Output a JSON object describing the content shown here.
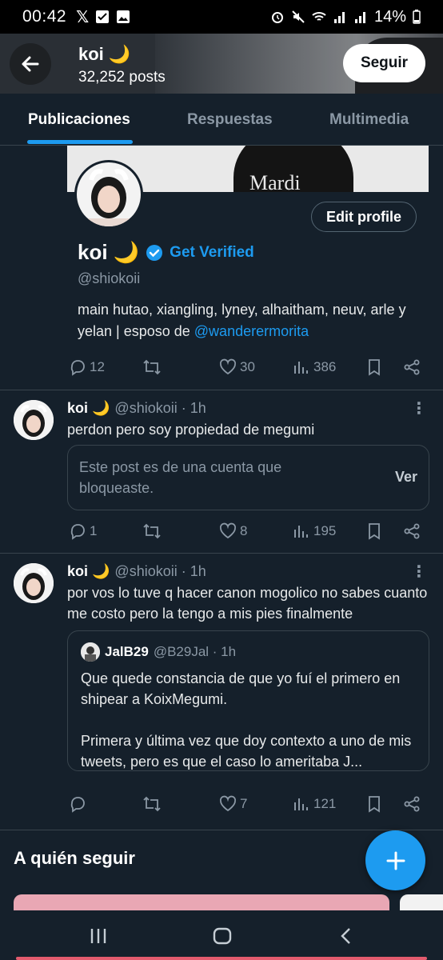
{
  "status_bar": {
    "time": "00:42",
    "battery": "14%"
  },
  "header": {
    "title": "koi 🌙",
    "posts_count": "32,252 posts",
    "follow_label": "Seguir"
  },
  "tabs": [
    {
      "label": "Publicaciones",
      "active": true
    },
    {
      "label": "Respuestas",
      "active": false
    },
    {
      "label": "Multimedia",
      "active": false
    }
  ],
  "profile_card": {
    "edit_label": "Edit profile",
    "name": "koi 🌙",
    "get_verified": "Get Verified",
    "handle": "@shiokoii",
    "bio_text": "main hutao, xiangling, lyney, alhaitham, neuv, arle y yelan | esposo de ",
    "bio_mention": "@wanderermorita",
    "banner_text": "Mardi",
    "stats": {
      "replies": "12",
      "likes": "30",
      "views": "386"
    }
  },
  "tweets": [
    {
      "name": "koi 🌙",
      "meta": "@shiokoii · 1h",
      "text": "perdon pero soy propiedad de megumi",
      "blocked_text": "Este post es de una cuenta que bloqueaste.",
      "blocked_action": "Ver",
      "stats": {
        "replies": "1",
        "likes": "8",
        "views": "195"
      }
    },
    {
      "name": "koi 🌙",
      "meta": "@shiokoii · 1h",
      "text": "por vos lo tuve q hacer canon mogolico no sabes cuanto me costo pero la tengo a mis pies finalmente",
      "quote": {
        "name": "JalB29",
        "meta": "@B29Jal · 1h",
        "text_line1": "Que quede constancia de que yo fuí el primero en shipear a KoixMegumi.",
        "text_line2": "Primera y última vez que doy contexto a uno de mis tweets, pero es que el caso lo ameritaba J..."
      },
      "stats": {
        "replies": "",
        "likes": "7",
        "views": "121"
      }
    }
  ],
  "who_to_follow": "A quién seguir"
}
